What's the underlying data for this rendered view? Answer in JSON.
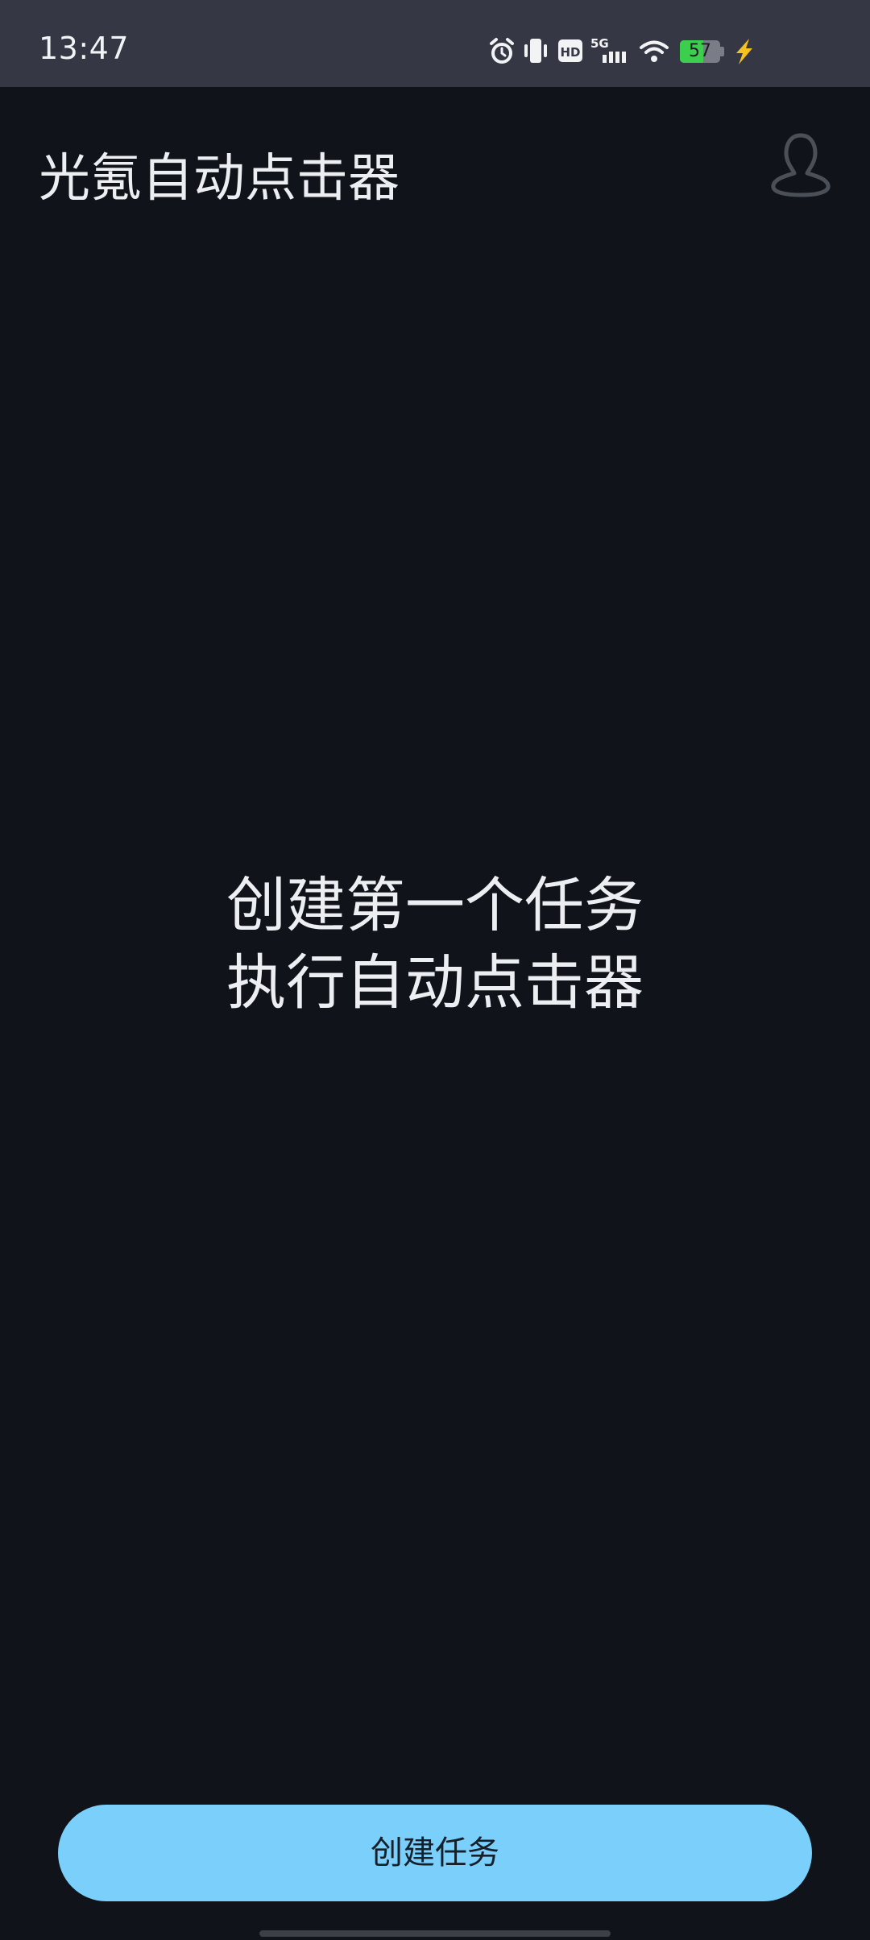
{
  "status_bar": {
    "time": "13:47",
    "network_label": "5G",
    "hd_label": "HD",
    "battery_level": "57",
    "icons": [
      "alarm-icon",
      "vibrate-icon",
      "hd-icon",
      "5g-signal-icon",
      "wifi-icon",
      "battery-icon",
      "charging-icon"
    ]
  },
  "header": {
    "title": "光氪自动点击器",
    "profile_icon": "user-profile-icon"
  },
  "empty_state": {
    "line1": "创建第一个任务",
    "line2": "执行自动点击器"
  },
  "primary_button": {
    "label": "创建任务"
  },
  "colors": {
    "background": "#10131a",
    "status_bar": "#353744",
    "accent": "#7acffb",
    "battery_green": "#3ccf4e",
    "charging_yellow": "#f6c21c"
  }
}
